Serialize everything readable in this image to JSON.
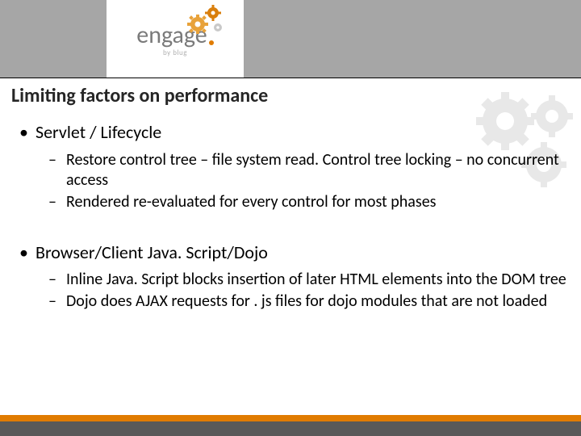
{
  "logo": {
    "word": "engage",
    "byline": "by blug"
  },
  "title": "Limiting factors on performance",
  "bullets": [
    {
      "text": "Servlet / Lifecycle",
      "subs": [
        "Restore control tree – file system read. Control tree locking – no concurrent access",
        "Rendered re-evaluated for every control for most phases"
      ]
    },
    {
      "text": "Browser/Client Java. Script/Dojo",
      "subs": [
        "Inline Java. Script blocks insertion of later HTML elements into the DOM tree",
        "Dojo does AJAX requests for . js files for dojo modules that are not loaded"
      ]
    }
  ]
}
